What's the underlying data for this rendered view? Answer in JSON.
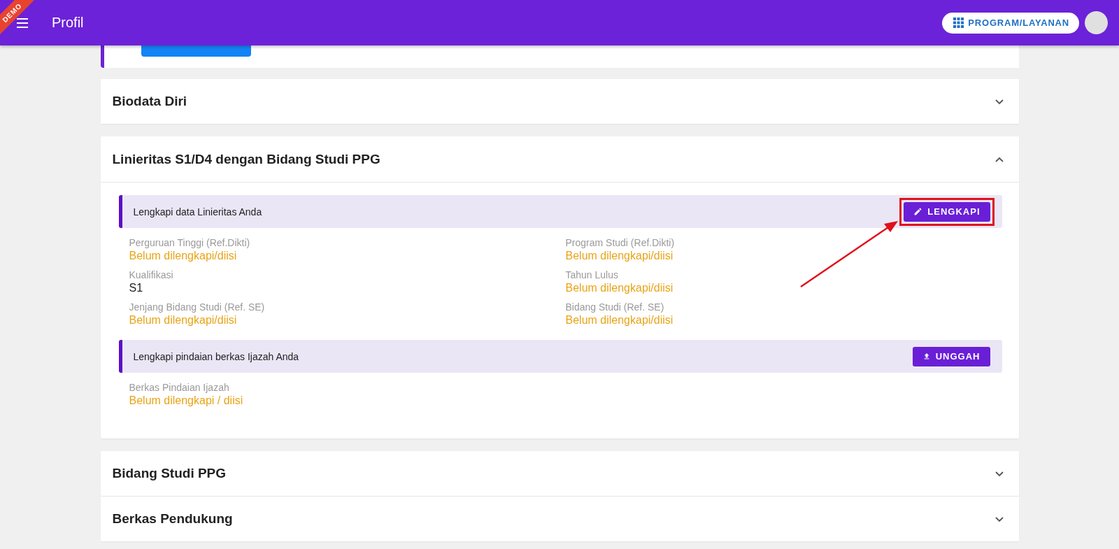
{
  "app_bar": {
    "ribbon": "DEMO",
    "title": "Profil",
    "program_button": "PROGRAM/LAYANAN"
  },
  "sections": [
    {
      "title": "Biodata Diri",
      "expanded": false
    },
    {
      "title": "Linieritas S1/D4 dengan Bidang Studi PPG",
      "expanded": true,
      "blocks": [
        {
          "message": "Lengkapi data Linieritas Anda",
          "button": {
            "label": "LENGKAPI",
            "kind": "edit"
          },
          "annotated": true,
          "fields": [
            {
              "label": "Perguruan Tinggi (Ref.Dikti)",
              "value": "Belum dilengkapi/diisi",
              "filled": false
            },
            {
              "label": "Program Studi (Ref.Dikti)",
              "value": "Belum dilengkapi/diisi",
              "filled": false
            },
            {
              "label": "Kualifikasi",
              "value": "S1",
              "filled": true
            },
            {
              "label": "Tahun Lulus",
              "value": "Belum dilengkapi/diisi",
              "filled": false
            },
            {
              "label": "Jenjang Bidang Studi (Ref. SE)",
              "value": "Belum dilengkapi/diisi",
              "filled": false
            },
            {
              "label": "Bidang Studi (Ref. SE)",
              "value": "Belum dilengkapi/diisi",
              "filled": false
            }
          ]
        },
        {
          "message": "Lengkapi pindaian berkas Ijazah Anda",
          "button": {
            "label": "UNGGAH",
            "kind": "upload"
          },
          "annotated": false,
          "fields": [
            {
              "label": "Berkas Pindaian Ijazah",
              "value": "Belum dilengkapi / diisi",
              "filled": false
            }
          ]
        }
      ]
    },
    {
      "title": "Bidang Studi PPG",
      "expanded": false
    },
    {
      "title": "Berkas Pendukung",
      "expanded": false
    }
  ]
}
